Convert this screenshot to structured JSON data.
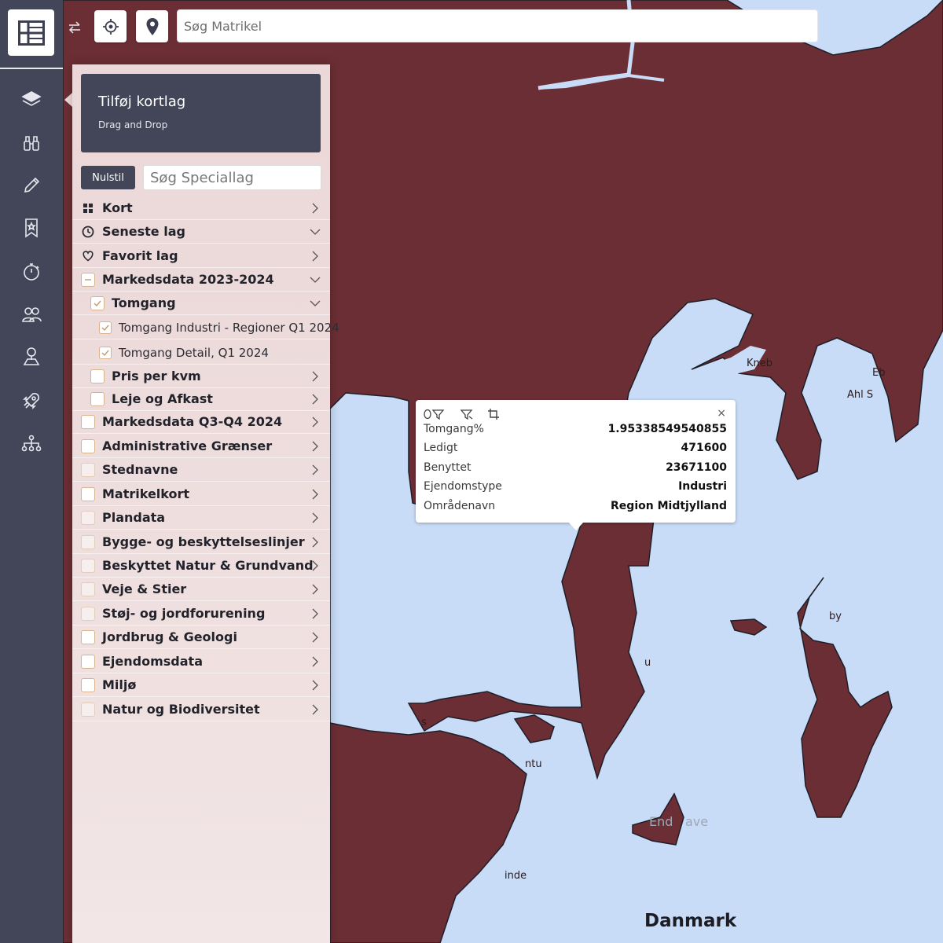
{
  "toolbar": {
    "search_placeholder": "Søg Matrikel"
  },
  "rail": {
    "items": [
      "layers-icon",
      "binoculars-icon",
      "pencil-icon",
      "bookmark-icon",
      "stopwatch-icon",
      "users-icon",
      "user-location-icon",
      "rocket-icon",
      "sitemap-icon"
    ]
  },
  "panel": {
    "add_layer_title": "Tilføj kortlag",
    "add_layer_subtitle": "Drag and Drop",
    "reset_label": "Nulstil",
    "search_placeholder": "Søg Speciallag",
    "rows": [
      {
        "label": "Kort",
        "icon": "grid-icon",
        "chevron": "right"
      },
      {
        "label": "Seneste lag",
        "icon": "clock-icon",
        "chevron": "down"
      },
      {
        "label": "Favorit lag",
        "icon": "heart-icon",
        "chevron": "right"
      },
      {
        "label": "Markedsdata 2023-2024",
        "checkbox": "indeterminate",
        "chevron": "down"
      },
      {
        "label": "Tomgang",
        "checkbox": "checked",
        "chevron": "down"
      },
      {
        "label": "Tomgang Industri - Regioner Q1 2024",
        "checkbox": "checked"
      },
      {
        "label": "Tomgang Detail, Q1 2024",
        "checkbox": "checked"
      },
      {
        "label": "Pris per kvm",
        "checkbox": "unchecked",
        "chevron": "right"
      },
      {
        "label": "Leje og Afkast",
        "checkbox": "unchecked",
        "chevron": "right"
      },
      {
        "label": "Markedsdata Q3-Q4 2024",
        "checkbox": "unchecked",
        "chevron": "right"
      },
      {
        "label": "Administrative Grænser",
        "checkbox": "unchecked",
        "chevron": "right"
      },
      {
        "label": "Stednavne",
        "checkbox": "unchecked",
        "chevron": "right"
      },
      {
        "label": "Matrikelkort",
        "checkbox": "unchecked",
        "chevron": "right"
      },
      {
        "label": "Plandata",
        "checkbox": "unchecked",
        "chevron": "right"
      },
      {
        "label": "Bygge- og beskyttelseslinjer",
        "checkbox": "unchecked",
        "chevron": "right"
      },
      {
        "label": "Beskyttet Natur & Grundvand",
        "checkbox": "unchecked",
        "chevron": "right"
      },
      {
        "label": "Veje & Stier",
        "checkbox": "unchecked",
        "chevron": "right"
      },
      {
        "label": "Støj- og jordforurening",
        "checkbox": "unchecked",
        "chevron": "right"
      },
      {
        "label": "Jordbrug & Geologi",
        "checkbox": "unchecked",
        "chevron": "right"
      },
      {
        "label": "Ejendomsdata",
        "checkbox": "unchecked",
        "chevron": "right"
      },
      {
        "label": "Miljø",
        "checkbox": "unchecked",
        "chevron": "right"
      },
      {
        "label": "Natur og Biodiversitet",
        "checkbox": "unchecked",
        "chevron": "right"
      }
    ]
  },
  "popup": {
    "rows": [
      {
        "key": "Tomgang%",
        "value": "1.95338549540855"
      },
      {
        "key": "Ledigt",
        "value": "471600"
      },
      {
        "key": "Benyttet",
        "value": "23671100"
      },
      {
        "key": "Ejendomstype",
        "value": "Industri"
      },
      {
        "key": "Områdenavn",
        "value": "Region Midtjylland"
      }
    ]
  },
  "map": {
    "labels": {
      "kneb": "Kneb",
      "ebe": "Eb",
      "ahl": "Ahl S",
      "by": "by",
      "u": "u",
      "s": "s",
      "ntu": "ntu",
      "endelave_a": "End",
      "endelave_b": "ave",
      "inde": "inde",
      "country": "Danmark"
    }
  },
  "colors": {
    "land": "#6b2e34",
    "water": "#c9dcf7",
    "rail": "#434658",
    "panel": "#f0dede",
    "accent_dark": "#434659",
    "checkbox_border": "#d8b48e"
  }
}
